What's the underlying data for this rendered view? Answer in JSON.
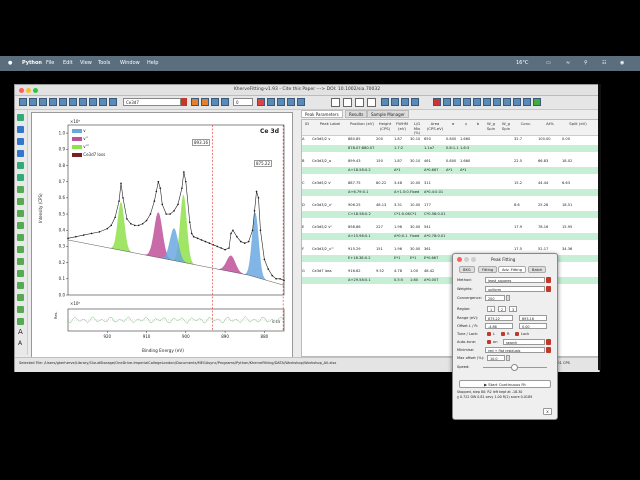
{
  "menubar": {
    "apple": "",
    "items": [
      "Python",
      "File",
      "Edit",
      "View",
      "Tools",
      "Window",
      "Help"
    ],
    "status": {
      "temp": "16°C",
      "time": ""
    }
  },
  "window": {
    "title": "KherveFitting-v1.93 - Cite this Paper ---> DOI: 10.1002/sia.70032",
    "file_selector": "Ce3d7",
    "zoom_value": "0"
  },
  "plot": {
    "region_label": "Ce 3d",
    "marker1": "893.16",
    "marker2": "875.22",
    "ylabel": "Intensity (CPS)",
    "xlabel": "Binding Energy (eV)",
    "y_scale": "×10⁵",
    "y_scale_bottom": "×10⁵",
    "res_label": "Res.",
    "res_value": "0.15",
    "legend": [
      {
        "label": "v",
        "color": "#6aa8e0"
      },
      {
        "label": "v''",
        "color": "#c0509a"
      },
      {
        "label": "v'''",
        "color": "#8fe04a"
      },
      {
        "label": "Ce3d7 loss",
        "color": "#7a2020"
      }
    ]
  },
  "chart_data": {
    "type": "line",
    "xlabel": "Binding Energy (eV)",
    "ylabel": "Intensity (CPS)",
    "title": "Ce 3d",
    "xlim": [
      930,
      875
    ],
    "ylim": [
      0.0,
      1.05
    ],
    "x": [
      930,
      928,
      926,
      924,
      922,
      920,
      919,
      918,
      917,
      916.5,
      916,
      915,
      914,
      913,
      912,
      911,
      910,
      909,
      908,
      907.5,
      907,
      906.5,
      906,
      905,
      904,
      903,
      902,
      901,
      900.5,
      900,
      899,
      898.5,
      898,
      897,
      896,
      895,
      894,
      893,
      892,
      891,
      890,
      889,
      888.5,
      888,
      887,
      886,
      885,
      884,
      883,
      882.5,
      882,
      881.5,
      881,
      880,
      879,
      878,
      877,
      876,
      875
    ],
    "y": [
      0.35,
      0.36,
      0.37,
      0.38,
      0.39,
      0.41,
      0.43,
      0.48,
      0.58,
      0.69,
      0.6,
      0.47,
      0.44,
      0.43,
      0.43,
      0.44,
      0.46,
      0.5,
      0.58,
      0.64,
      0.7,
      0.66,
      0.56,
      0.5,
      0.5,
      0.52,
      0.56,
      0.66,
      0.76,
      0.7,
      0.45,
      0.38,
      0.36,
      0.35,
      0.34,
      0.33,
      0.32,
      0.31,
      0.3,
      0.29,
      0.28,
      0.29,
      0.38,
      0.4,
      0.36,
      0.33,
      0.32,
      0.33,
      0.4,
      0.52,
      0.64,
      0.6,
      0.4,
      0.22,
      0.16,
      0.12,
      0.1,
      0.1,
      0.09
    ],
    "yticks": [
      "0.0",
      "0.1",
      "0.2",
      "0.3",
      "0.4",
      "0.5",
      "0.6",
      "0.7",
      "0.8",
      "0.9",
      "1.0"
    ],
    "xticks": [
      "920",
      "910",
      "900",
      "890",
      "880"
    ]
  },
  "tabs": [
    "Peak Parameters",
    "Results",
    "Sample Manager"
  ],
  "table": {
    "headers": [
      "ID",
      "Peak Label",
      "Position (eV)",
      "Height (CPS)",
      "FWHM (eV)",
      "L/G Mix (%)",
      "Area (CPS.eV)",
      "σ",
      "γ",
      "b",
      "W_g Spin",
      "W_g Spin",
      "Conc.",
      "At%",
      "Split (eV)"
    ],
    "rows": [
      {
        "id": "A",
        "label": "Ce3d5/2 v",
        "pos": "880.85",
        "h": "200",
        "fw": "1.87",
        "lg": "30.10",
        "area": "650",
        "s": "0.800",
        "g": "1.660",
        "b": "",
        "w1": "",
        "w2": "",
        "conc": "32.7",
        "at": "100.00",
        "sp": "0.00",
        "hl": false
      },
      {
        "id": "",
        "label": "",
        "pos": "878.07:880.07",
        "h": "",
        "fw": "1.7:2",
        "lg": "",
        "area": "1.1a7",
        "s": "0.8:1.1",
        "g": "1.6:3",
        "b": "",
        "w1": "",
        "w2": "",
        "conc": "",
        "at": "",
        "sp": "",
        "hl": true
      },
      {
        "id": "B",
        "label": "Ce3d3/2_a",
        "pos": "899.43",
        "h": "150",
        "fw": "1.87",
        "lg": "30.10",
        "area": "461",
        "s": "0.800",
        "g": "1.660",
        "b": "",
        "w1": "",
        "w2": "",
        "conc": "22.5",
        "at": "66.83",
        "sp": "18.02",
        "hl": false
      },
      {
        "id": "",
        "label": "",
        "pos": "A+18.58:0.2",
        "h": "",
        "fw": "A*1",
        "lg": "",
        "area": "A*0.667",
        "s": "A*1",
        "g": "A*1",
        "b": "",
        "w1": "",
        "w2": "",
        "conc": "",
        "at": "",
        "sp": "",
        "hl": true
      },
      {
        "id": "C",
        "label": "Ce3d5/2 v'",
        "pos": "887.75",
        "h": "80.22",
        "fw": "3.48",
        "lg": "10.00",
        "area": "311",
        "s": "",
        "g": "",
        "b": "",
        "w1": "",
        "w2": "",
        "conc": "15.2",
        "at": "44.44",
        "sp": "6.63",
        "hl": false
      },
      {
        "id": "",
        "label": "",
        "pos": "A+6.79:0.1",
        "h": "",
        "fw": "A+1.5:0.1",
        "lg": "Fixed",
        "area": "A*0.4:0.01",
        "s": "",
        "g": "",
        "b": "",
        "w1": "",
        "w2": "",
        "conc": "",
        "at": "",
        "sp": "",
        "hl": true
      },
      {
        "id": "D",
        "label": "Ce3d3/2_v'",
        "pos": "906.25",
        "h": "48.13",
        "fw": "3.31",
        "lg": "10.00",
        "area": "177",
        "s": "",
        "g": "",
        "b": "",
        "w1": "",
        "w2": "",
        "conc": "8.6",
        "at": "25.28",
        "sp": "18.51",
        "hl": false
      },
      {
        "id": "",
        "label": "",
        "pos": "C+18.58:0.2",
        "h": "",
        "fw": "C*1:0.06",
        "lg": "C*1",
        "area": "C*0.58:0.01",
        "s": "",
        "g": "",
        "b": "",
        "w1": "",
        "w2": "",
        "conc": "",
        "at": "",
        "sp": "",
        "hl": true
      },
      {
        "id": "E",
        "label": "Ce3d5/2 v''",
        "pos": "898.86",
        "h": "227",
        "fw": "1.96",
        "lg": "30.00",
        "area": "541",
        "s": "",
        "g": "",
        "b": "",
        "w1": "",
        "w2": "",
        "conc": "17.9",
        "at": "78.16",
        "sp": "15.95",
        "hl": false
      },
      {
        "id": "",
        "label": "",
        "pos": "A+15.98:0.1",
        "h": "",
        "fw": "A*0:0.1",
        "lg": "Fixed",
        "area": "A*0.78:0.01",
        "s": "",
        "g": "",
        "b": "",
        "w1": "",
        "w2": "",
        "conc": "",
        "at": "",
        "sp": "",
        "hl": true
      },
      {
        "id": "F",
        "label": "Ce3d3/2_v'''",
        "pos": "915.29",
        "h": "151",
        "fw": "1.96",
        "lg": "30.00",
        "area": "361",
        "s": "",
        "g": "",
        "b": "",
        "w1": "",
        "w2": "",
        "conc": "17.5",
        "at": "52.17",
        "sp": "34.36",
        "hl": false
      },
      {
        "id": "",
        "label": "",
        "pos": "E+18.38:0.2",
        "h": "",
        "fw": "E*1",
        "lg": "E*1",
        "area": "E*0.667",
        "s": "",
        "g": "",
        "b": "",
        "w1": "",
        "w2": "",
        "conc": "",
        "at": "",
        "sp": "",
        "hl": true
      },
      {
        "id": "G",
        "label": "Ce3d7 loss",
        "pos": "916.62",
        "h": "9.52",
        "fw": "4.78",
        "lg": "1.00",
        "area": "48.42",
        "s": "",
        "g": "",
        "b": "",
        "w1": "",
        "w2": "",
        "conc": "",
        "at": "",
        "sp": "",
        "hl": false
      },
      {
        "id": "",
        "label": "",
        "pos": "A+29.58:0.1",
        "h": "",
        "fw": "0.5:5",
        "lg": "1:80",
        "area": "A*0.007",
        "s": "",
        "g": "",
        "b": "",
        "w1": "",
        "w2": "",
        "conc": "",
        "at": "",
        "sp": "",
        "hl": true
      }
    ]
  },
  "statusbar": {
    "path": "Selected File: /Users/gkerherve/Library/CloudStorage/OneDrive-ImperialCollegeLondon/Documents/MEGAsync/Programs/Python/KherveFitting/DATA/Workshop/Workshop_All.xlsx",
    "right": "840.001 CPS"
  },
  "popup": {
    "title": "Peak Fitting",
    "tabs": [
      "BKG",
      "Fitting",
      "Adv. Fitting",
      "Batch"
    ],
    "method_label": "Method:",
    "method_value": "least_squares",
    "weights_label": "Weights:",
    "weights_value": "uniform",
    "convergence_label": "Convergence:",
    "convergence_value": "200",
    "region_label": "Region:",
    "region_values": [
      "1",
      "2",
      "3"
    ],
    "range_label": "Range (eV):",
    "range_from": "875.22",
    "range_to": "893.16",
    "offset_label": "Offset L / R:",
    "offset_l": "-4.86",
    "offset_r": "0.00",
    "tune_label": "Tune / Lock:",
    "tune_l": "L",
    "tune_r": "R",
    "tune_lock": "Lock",
    "autotune_label": "Auto-tune:",
    "autotune_on": "on",
    "autotune_value": "search",
    "minimise_label": "Minimise:",
    "minimise_value": "red + flat residuals",
    "maxoffset_label": "Max offset (%):",
    "maxoffset_value": "10.0",
    "speed_label": "Speed:",
    "start_button": "Start Continuous Fit",
    "log_line1": "Stopped, step 80: R2 left kept at -18.30",
    "log_line2": "χ 0.722 DW 0.81 sevy 1.00 R(2) score 0.0189",
    "close_button": "X"
  }
}
